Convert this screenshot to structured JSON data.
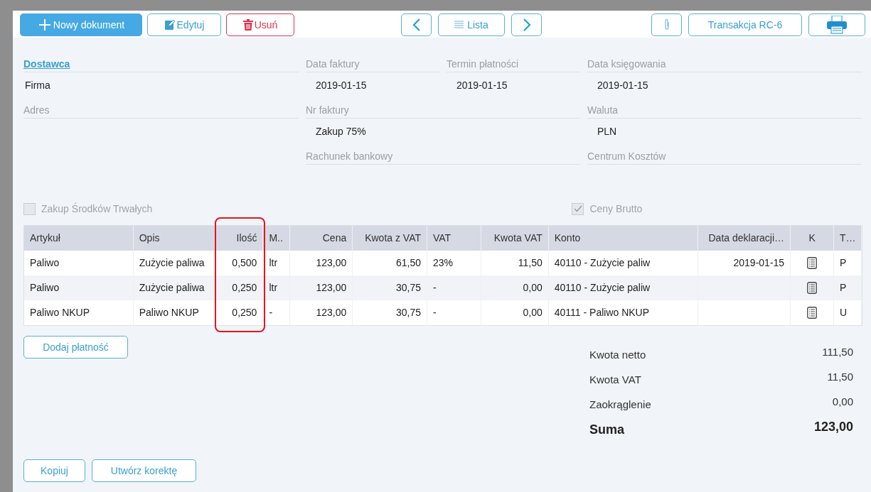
{
  "toolbar": {
    "buttons": [
      {
        "kind": "primary",
        "label": "Nowy dokument"
      },
      {
        "kind": "outline",
        "label": "Edytuj"
      },
      {
        "kind": "danger",
        "label": "Usuń"
      }
    ],
    "nav": [
      {
        "kind": "prev"
      },
      {
        "kind": "list",
        "label": "Lista"
      },
      {
        "kind": "next"
      }
    ],
    "right": [
      {
        "kind": "attach"
      },
      {
        "kind": "text",
        "label": "Transakcja RC-6"
      },
      {
        "kind": "pdf"
      }
    ]
  },
  "form": {
    "supplier": {
      "label": "Dostawca",
      "value": "Firma"
    },
    "address": {
      "label": "Adres"
    },
    "invoice_date": {
      "label": "Data faktury",
      "value": "2019-01-15"
    },
    "due_date": {
      "label": "Termin płatności",
      "value": "2019-01-15"
    },
    "posting_date": {
      "label": "Data księgowania",
      "value": "2019-01-15"
    },
    "invoice_no": {
      "label": "Nr faktury",
      "value": "Zakup 75%"
    },
    "currency": {
      "label": "Waluta",
      "value": "PLN"
    },
    "bank_account": {
      "label": "Rachunek bankowy"
    },
    "cost_center": {
      "label": "Centrum Kosztów"
    }
  },
  "checkboxes": [
    {
      "label": "Zakup Środków Trwałych",
      "checked": false
    },
    {
      "label": "Ceny Brutto",
      "checked": true
    }
  ],
  "table": {
    "columns": [
      {
        "label": "Artykuł",
        "highlighted": false
      },
      {
        "label": "Opis",
        "highlighted": false
      },
      {
        "label": "Ilość",
        "highlighted": true
      },
      {
        "label": "M..",
        "highlighted": false
      },
      {
        "label": "Cena",
        "highlighted": false
      },
      {
        "label": "Kwota z VAT",
        "highlighted": false
      },
      {
        "label": "VAT",
        "highlighted": false
      },
      {
        "label": "Kwota VAT",
        "highlighted": false
      },
      {
        "label": "Konto",
        "highlighted": false
      },
      {
        "label": "Data deklaracji…",
        "highlighted": false
      },
      {
        "label": "K",
        "highlighted": false
      },
      {
        "label": "T…",
        "highlighted": false
      }
    ],
    "rows": [
      [
        "Paliwo",
        "Zużycie paliwa",
        "0,500",
        "ltr",
        "123,00",
        "61,50",
        "23%",
        "11,50",
        "40110 - Zużycie paliw",
        "2019-01-15",
        {
          "kind": "icon"
        },
        "P"
      ],
      [
        "Paliwo",
        "Zużycie paliwa",
        "0,250",
        "ltr",
        "123,00",
        "30,75",
        "-",
        "0,00",
        "40110 - Zużycie paliw",
        "",
        {
          "kind": "icon"
        },
        "P"
      ],
      [
        "Paliwo NKUP",
        "Paliwo NKUP",
        "0,250",
        "-",
        "123,00",
        "30,75",
        "-",
        "0,00",
        "40111 - Paliwo NKUP",
        "",
        {
          "kind": "icon"
        },
        "U"
      ]
    ]
  },
  "add_payment": "Dodaj płatność",
  "totals": [
    {
      "kind": "line",
      "label": "Kwota netto",
      "value": "111,50"
    },
    {
      "kind": "line",
      "label": "Kwota VAT",
      "value": "11,50"
    },
    {
      "kind": "line",
      "label": "Zaokrąglenie",
      "value": "0,00"
    },
    {
      "kind": "sum",
      "label": "Suma",
      "value": "123,00"
    }
  ],
  "footer_buttons": [
    "Kopiuj",
    "Utwórz korektę"
  ]
}
